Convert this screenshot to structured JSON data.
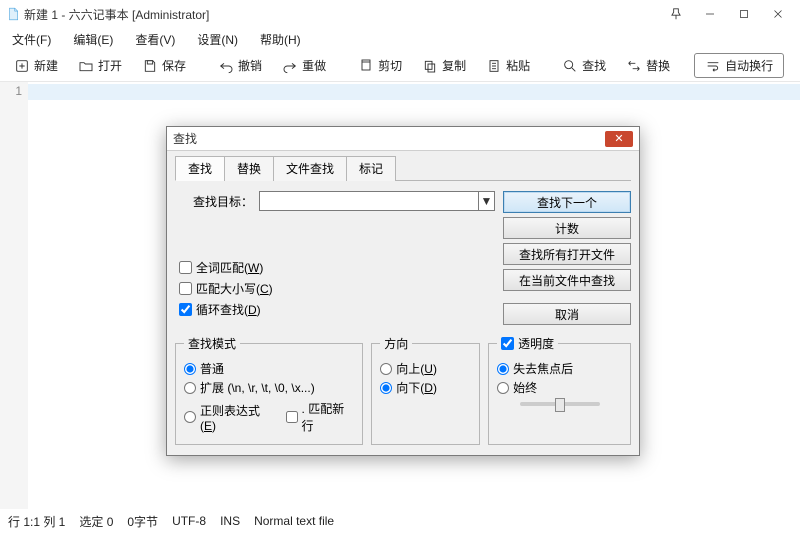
{
  "title": "新建 1 - 六六记事本 [Administrator]",
  "menus": {
    "file": "文件(F)",
    "edit": "编辑(E)",
    "view": "查看(V)",
    "settings": "设置(N)",
    "help": "帮助(H)"
  },
  "toolbar": {
    "new": "新建",
    "open": "打开",
    "save": "保存",
    "undo": "撤销",
    "redo": "重做",
    "cut": "剪切",
    "copy": "复制",
    "paste": "粘贴",
    "find": "查找",
    "replace": "替换",
    "wrap": "自动换行"
  },
  "gutter_line": "1",
  "status": {
    "pos": "行 1:1  列 1",
    "sel": "选定 0",
    "bytes": "0字节",
    "enc": "UTF-8",
    "ins": "INS",
    "ft": "Normal text file"
  },
  "dialog": {
    "title": "查找",
    "tabs": {
      "find": "查找",
      "replace": "替换",
      "files": "文件查找",
      "mark": "标记"
    },
    "target_label": "查找目标：",
    "target_value": "",
    "buttons": {
      "findnext": "查找下一个",
      "count": "计数",
      "findall": "查找所有打开文件",
      "findcurrent": "在当前文件中查找",
      "cancel": "取消"
    },
    "checks": {
      "whole_pre": "全词匹配(",
      "whole_key": "W",
      "whole_post": ")",
      "case_pre": "匹配大小写(",
      "case_key": "C",
      "case_post": ")",
      "loop_pre": "循环查找(",
      "loop_key": "D",
      "loop_post": ")"
    },
    "mode": {
      "legend": "查找模式",
      "normal": "普通",
      "ext": "扩展 (\\n, \\r, \\t, \\0, \\x...)",
      "regex_pre": "正则表达式(",
      "regex_key": "E",
      "regex_post": ")",
      "dotnl": ". 匹配新行"
    },
    "dir": {
      "legend": "方向",
      "up_pre": "向上(",
      "up_key": "U",
      "up_post": ")",
      "down_pre": "向下(",
      "down_key": "D",
      "down_post": ")"
    },
    "trans": {
      "legend": "透明度",
      "onblur": "失去焦点后",
      "always": "始终"
    }
  }
}
